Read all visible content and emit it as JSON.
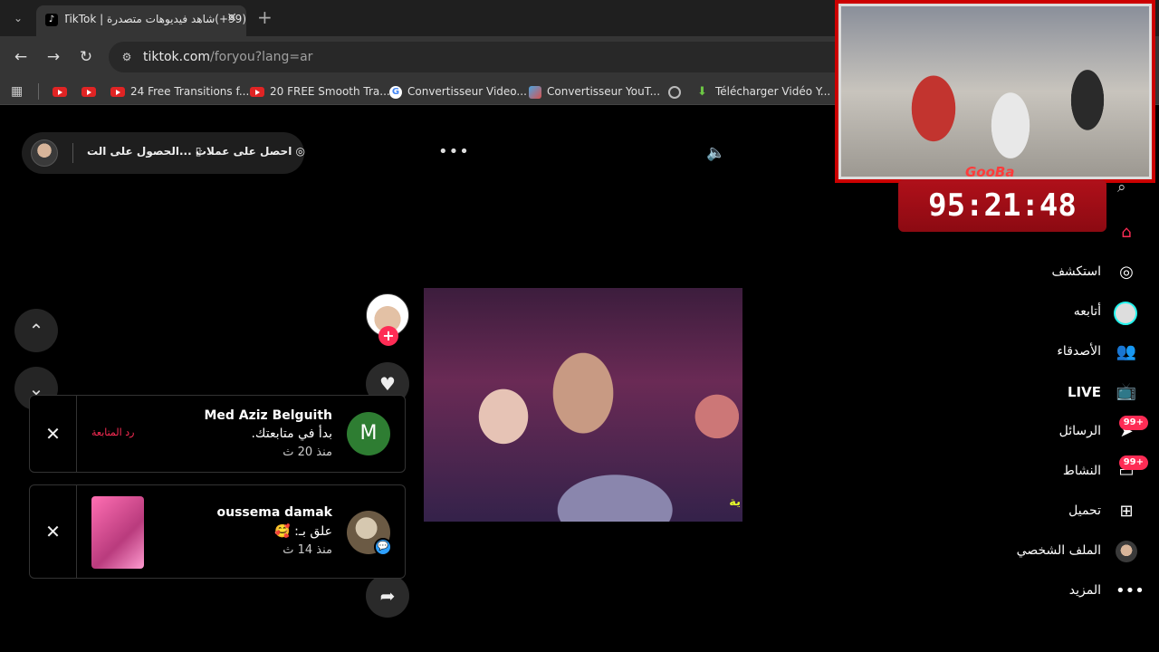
{
  "browser": {
    "tab_title": "(99+)شاهد فيديوهات متصدرة | TikTok",
    "url_domain": "tiktok.com",
    "url_path": "/foryou?lang=ar",
    "bookmarks": [
      "",
      "",
      "24 Free Transitions f...",
      "20 FREE Smooth Tra...",
      "Convertisseur Video...",
      "Convertisseur YouT...",
      "",
      "Télécharger Vidéo Y..."
    ]
  },
  "topbar": {
    "get_coins": "احصل على عملات",
    "get_app": "الحصول على الت..."
  },
  "video": {
    "overlay_text": "ية"
  },
  "notifications": [
    {
      "name": "Med Aziz Belguith",
      "message": "بدأ في متابعتك.",
      "time": "منذ 20 ث",
      "action": "رد المتابعة",
      "avatar_letter": "M",
      "avatar_color": "#2e7d32"
    },
    {
      "name": "oussema damak",
      "message": "علق بـ: 🥰",
      "time": "منذ 14 ث"
    }
  ],
  "sidebar": {
    "items": [
      {
        "label": "",
        "icon": "home-icon",
        "active": true
      },
      {
        "label": "استكشف",
        "icon": "compass-icon"
      },
      {
        "label": "أتابعه",
        "icon": "following-icon"
      },
      {
        "label": "الأصدقاء",
        "icon": "friends-icon"
      },
      {
        "label": "LIVE",
        "icon": "live-icon"
      },
      {
        "label": "الرسائل",
        "icon": "messages-icon",
        "badge": "99+"
      },
      {
        "label": "النشاط",
        "icon": "activity-icon",
        "badge": "99+"
      },
      {
        "label": "تحميل",
        "icon": "upload-icon"
      },
      {
        "label": "الملف الشخصي",
        "icon": "profile-avatar"
      },
      {
        "label": "المزيد",
        "icon": "more-icon"
      }
    ]
  },
  "stream_overlay": {
    "logo": "GooBa",
    "timer": "95:21:48"
  },
  "colors": {
    "accent": "#fe2c55",
    "timer_bg": "#b0101a"
  }
}
